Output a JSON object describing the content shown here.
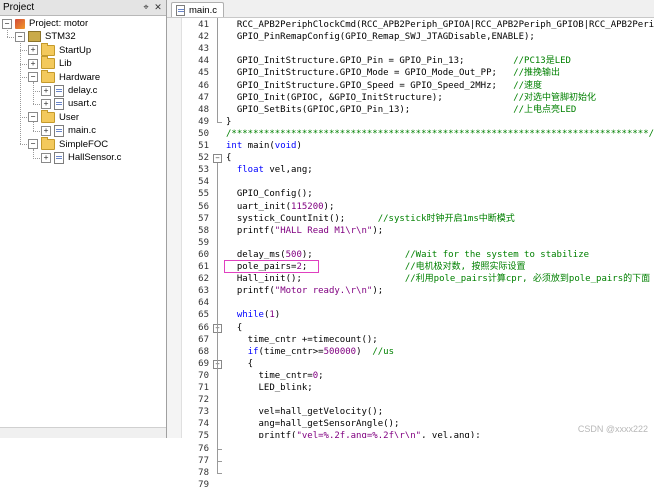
{
  "project_panel": {
    "title": "Project",
    "pin_icon": "pin-icon",
    "close_icon": "close-icon",
    "tree": [
      {
        "label": "Project: motor",
        "type": "project",
        "depth": 0,
        "expanded": true
      },
      {
        "label": "STM32",
        "type": "target",
        "depth": 1,
        "expanded": true
      },
      {
        "label": "StartUp",
        "type": "folder",
        "depth": 2,
        "expanded": false
      },
      {
        "label": "Lib",
        "type": "folder",
        "depth": 2,
        "expanded": false
      },
      {
        "label": "Hardware",
        "type": "folder",
        "depth": 2,
        "expanded": true
      },
      {
        "label": "delay.c",
        "type": "file",
        "depth": 3,
        "expanded": false
      },
      {
        "label": "usart.c",
        "type": "file",
        "depth": 3,
        "expanded": false
      },
      {
        "label": "User",
        "type": "folder",
        "depth": 2,
        "expanded": true
      },
      {
        "label": "main.c",
        "type": "file",
        "depth": 3,
        "expanded": false
      },
      {
        "label": "SimpleFOC",
        "type": "folder",
        "depth": 2,
        "expanded": true
      },
      {
        "label": "HallSensor.c",
        "type": "file",
        "depth": 3,
        "expanded": false
      }
    ]
  },
  "editor": {
    "active_tab": "main.c",
    "lines": [
      {
        "n": "41",
        "code": "  RCC_APB2PeriphClockCmd(RCC_APB2Periph_GPIOA|RCC_APB2Periph_GPIOB|RCC_APB2Periph",
        "comment": ""
      },
      {
        "n": "42",
        "code": "  GPIO_PinRemapConfig(GPIO_Remap_SWJ_JTAGDisable,ENABLE);",
        "comment": ""
      },
      {
        "n": "43",
        "code": "",
        "comment": ""
      },
      {
        "n": "44",
        "code": "  GPIO_InitStructure.GPIO_Pin = GPIO_Pin_13;         ",
        "comment": "//PC13是LED"
      },
      {
        "n": "45",
        "code": "  GPIO_InitStructure.GPIO_Mode = GPIO_Mode_Out_PP;   ",
        "comment": "//推挽输出"
      },
      {
        "n": "46",
        "code": "  GPIO_InitStructure.GPIO_Speed = GPIO_Speed_2MHz;   ",
        "comment": "//速度"
      },
      {
        "n": "47",
        "code": "  GPIO_Init(GPIOC, &GPIO_InitStructure);             ",
        "comment": "//对选中管脚初始化"
      },
      {
        "n": "48",
        "code": "  GPIO_SetBits(GPIOC,GPIO_Pin_13);                   ",
        "comment": "//上电点亮LED"
      },
      {
        "n": "49",
        "code": "}",
        "comment": ""
      },
      {
        "n": "50",
        "code": "",
        "comment": "/*****************************************************************************/"
      },
      {
        "n": "51",
        "code": "int main(void)",
        "comment": ""
      },
      {
        "n": "52",
        "code": "{",
        "comment": ""
      },
      {
        "n": "53",
        "code": "  float vel,ang;",
        "comment": ""
      },
      {
        "n": "54",
        "code": "",
        "comment": ""
      },
      {
        "n": "55",
        "code": "  GPIO_Config();",
        "comment": ""
      },
      {
        "n": "56",
        "code": "  uart_init(115200);",
        "comment": ""
      },
      {
        "n": "57",
        "code": "  systick_CountInit();      ",
        "comment": "//systick时钟开启1ms中断模式"
      },
      {
        "n": "58",
        "code": "  printf(\"HALL Read M1\\r\\n\");",
        "comment": ""
      },
      {
        "n": "59",
        "code": "",
        "comment": ""
      },
      {
        "n": "60",
        "code": "  delay_ms(500);                 ",
        "comment": "//Wait for the system to stabilize"
      },
      {
        "n": "61",
        "code": "  pole_pairs=2;                  ",
        "comment": "//电机极对数, 按照实际设置"
      },
      {
        "n": "62",
        "code": "  Hall_init();                   ",
        "comment": "//利用pole_pairs计算cpr, 必须放到pole_pairs的下面"
      },
      {
        "n": "63",
        "code": "  printf(\"Motor ready.\\r\\n\");",
        "comment": ""
      },
      {
        "n": "64",
        "code": "",
        "comment": ""
      },
      {
        "n": "65",
        "code": "  while(1)",
        "comment": ""
      },
      {
        "n": "66",
        "code": "  {",
        "comment": ""
      },
      {
        "n": "67",
        "code": "    time_cntr +=timecount();",
        "comment": ""
      },
      {
        "n": "68",
        "code": "    if(time_cntr>=500000)  ",
        "comment": "//us"
      },
      {
        "n": "69",
        "code": "    {",
        "comment": ""
      },
      {
        "n": "70",
        "code": "      time_cntr=0;",
        "comment": ""
      },
      {
        "n": "71",
        "code": "      LED_blink;",
        "comment": ""
      },
      {
        "n": "72",
        "code": "",
        "comment": ""
      },
      {
        "n": "73",
        "code": "      vel=hall_getVelocity();",
        "comment": ""
      },
      {
        "n": "74",
        "code": "      ang=hall_getSensorAngle();",
        "comment": ""
      },
      {
        "n": "75",
        "code": "      printf(\"vel=%.2f,ang=%.2f\\r\\n\", vel,ang);",
        "comment": ""
      },
      {
        "n": "76",
        "code": "    }",
        "comment": ""
      },
      {
        "n": "77",
        "code": "  }",
        "comment": ""
      },
      {
        "n": "78",
        "code": "}",
        "comment": ""
      },
      {
        "n": "79",
        "code": "",
        "comment": "/*****************************************************************************/"
      }
    ]
  },
  "watermark": "CSDN @xxxx222",
  "colors": {
    "keyword": "#0000ff",
    "comment": "#008000",
    "string": "#800080",
    "highlight_box": "#e040c0"
  }
}
